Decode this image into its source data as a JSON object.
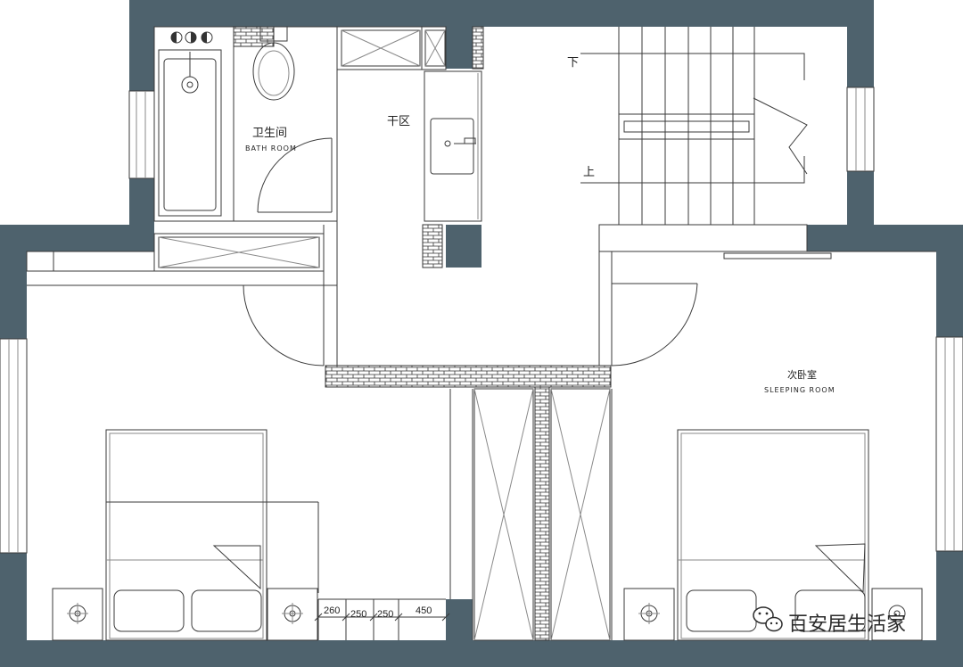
{
  "rooms": {
    "bathroom": {
      "cn": "卫生间",
      "en": "BATH ROOM"
    },
    "dry_area": {
      "cn": "干区"
    },
    "bedroom": {
      "cn": "次卧室",
      "en": "SLEEPING ROOM"
    }
  },
  "stairs": {
    "down": "下",
    "up": "上"
  },
  "dimensions": [
    "260",
    "250",
    "250",
    "450"
  ],
  "watermark": {
    "text": "百安居生活家",
    "icon": "wechat-icon"
  },
  "colors": {
    "wall": "#4e626d",
    "line": "#3a3a3a"
  }
}
